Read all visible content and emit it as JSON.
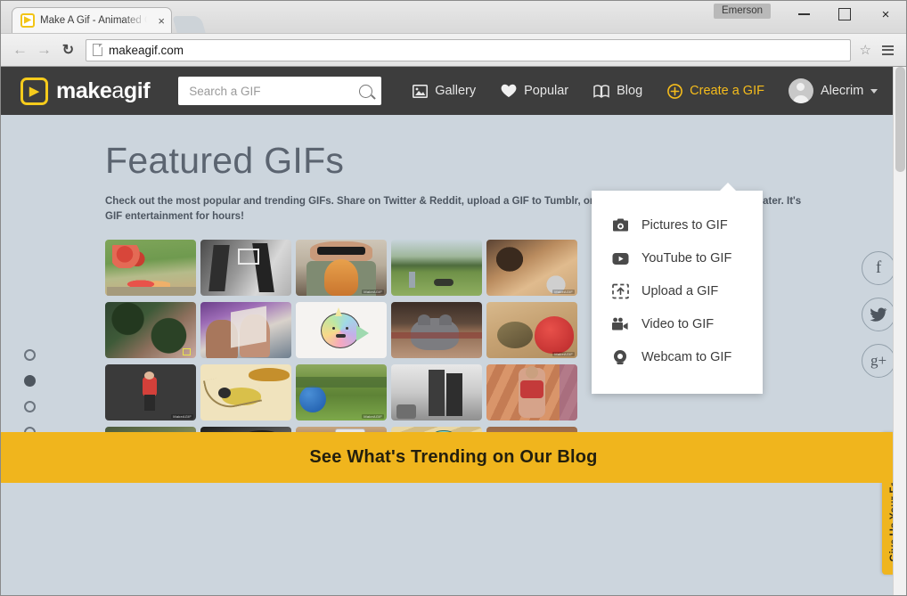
{
  "browser": {
    "tab": {
      "title": "Make A Gif - Animated Gif",
      "favicon": "play-icon",
      "close": "×"
    },
    "window_user": "Emerson",
    "controls": {
      "minimize": "minimize-icon",
      "maximize": "maximize-icon",
      "close": "×"
    },
    "toolbar": {
      "back": "←",
      "forward": "→",
      "reload": "↻",
      "url": "makeagif.com",
      "star": "☆",
      "menu": "hamburger-icon"
    }
  },
  "header": {
    "logo": {
      "mark": "▶",
      "bold": "make",
      "light": "a",
      "bold2": "gif"
    },
    "search": {
      "value": "",
      "placeholder": "Search a GIF"
    },
    "nav": [
      {
        "label": "Gallery",
        "icon": "image-icon",
        "accent": false
      },
      {
        "label": "Popular",
        "icon": "heart-icon",
        "accent": false
      },
      {
        "label": "Blog",
        "icon": "book-icon",
        "accent": false
      },
      {
        "label": "Create a GIF",
        "icon": "plus-circle-icon",
        "accent": true
      }
    ],
    "user": {
      "name": "Alecrim",
      "avatar": "avatar-icon",
      "caret": "chevron-down-icon"
    }
  },
  "dropdown": {
    "open": true,
    "items": [
      {
        "label": "Pictures to GIF",
        "icon": "pictures-icon"
      },
      {
        "label": "YouTube to GIF",
        "icon": "youtube-icon"
      },
      {
        "label": "Upload a GIF",
        "icon": "upload-icon"
      },
      {
        "label": "Video to GIF",
        "icon": "video-camera-icon"
      },
      {
        "label": "Webcam to GIF",
        "icon": "webcam-icon"
      }
    ]
  },
  "main": {
    "title": "Featured GIFs",
    "description": "Check out the most popular and trending GIFs. Share on Twitter & Reddit, upload a GIF to Tumblr, or download it to your computer for later. It's GIF entertainment for hours!",
    "pager": {
      "count": 4,
      "active_index": 1
    },
    "gif_count": 20,
    "watermark": "MakeAGIF"
  },
  "social": [
    {
      "name": "facebook",
      "glyph": "f"
    },
    {
      "name": "twitter",
      "glyph": "🐦"
    },
    {
      "name": "googleplus",
      "glyph": "g+"
    }
  ],
  "feedback": {
    "label": "Give Us Your Feedback",
    "color": "#efb51f"
  },
  "banner": {
    "label": "See What's Trending on Our Blog",
    "color": "#f0b51d"
  },
  "colors": {
    "header_bg": "#3d3d3d",
    "page_bg": "#ccd5dd",
    "accent_yellow": "#f5bc1c",
    "heading": "#5b6470"
  }
}
